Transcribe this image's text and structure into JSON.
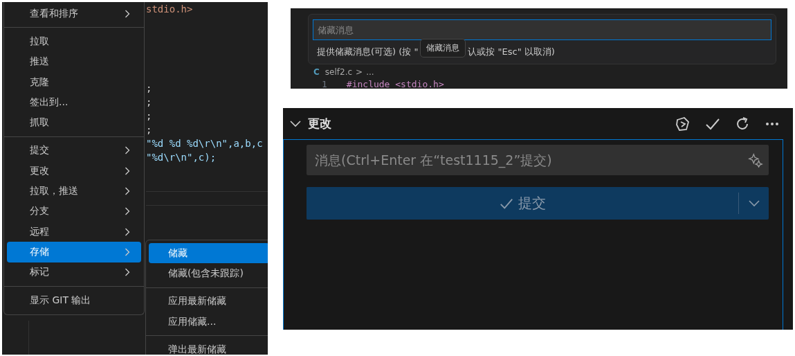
{
  "editor": {
    "top_line": "stdio.h>",
    "lines": [
      {
        "text": ";",
        "kind": "plain"
      },
      {
        "text": ";",
        "kind": "plain"
      },
      {
        "text": ";",
        "kind": "plain"
      },
      {
        "text": ";",
        "kind": "plain"
      },
      {
        "text": "\"%d %d %d\\r\\n\",a,b,c",
        "kind": "string"
      },
      {
        "text": "\"%d\\r\\n\",c);",
        "kind": "string"
      }
    ]
  },
  "context_menu": {
    "groups": [
      [
        {
          "label": "查看和排序",
          "submenu": true,
          "selected": false
        }
      ],
      [
        {
          "label": "拉取",
          "submenu": false,
          "selected": false
        },
        {
          "label": "推送",
          "submenu": false,
          "selected": false
        },
        {
          "label": "克隆",
          "submenu": false,
          "selected": false
        },
        {
          "label": "签出到...",
          "submenu": false,
          "selected": false
        },
        {
          "label": "抓取",
          "submenu": false,
          "selected": false
        }
      ],
      [
        {
          "label": "提交",
          "submenu": true,
          "selected": false
        },
        {
          "label": "更改",
          "submenu": true,
          "selected": false
        },
        {
          "label": "拉取，推送",
          "submenu": true,
          "selected": false
        },
        {
          "label": "分支",
          "submenu": true,
          "selected": false
        },
        {
          "label": "远程",
          "submenu": true,
          "selected": false
        },
        {
          "label": "存储",
          "submenu": true,
          "selected": true
        },
        {
          "label": "标记",
          "submenu": true,
          "selected": false
        }
      ],
      [
        {
          "label": "显示 GIT 输出",
          "submenu": false,
          "selected": false
        }
      ]
    ]
  },
  "stash_submenu": {
    "groups": [
      [
        {
          "label": "储藏",
          "selected": true
        },
        {
          "label": "储藏(包含未跟踪)",
          "selected": false
        }
      ],
      [
        {
          "label": "应用最新储藏",
          "selected": false
        },
        {
          "label": "应用储藏...",
          "selected": false
        }
      ],
      [
        {
          "label": "弹出最新储藏",
          "selected": false
        }
      ]
    ]
  },
  "quick_input": {
    "placeholder": "储藏消息",
    "hint_before": "提供储藏消息(可选) (按 \"",
    "hint_after": "认或按 \"Esc\" 以取消)",
    "tooltip": "储藏消息"
  },
  "breadcrumb": {
    "file_icon": "C",
    "file": "self2.c",
    "separator": ">",
    "rest": "..."
  },
  "code_line": {
    "number": "1",
    "text": "#include <stdio.h>"
  },
  "scm": {
    "section": "更改",
    "message_placeholder": "消息(Ctrl+Enter 在“test1115_2”提交)",
    "commit_label": "提交"
  }
}
